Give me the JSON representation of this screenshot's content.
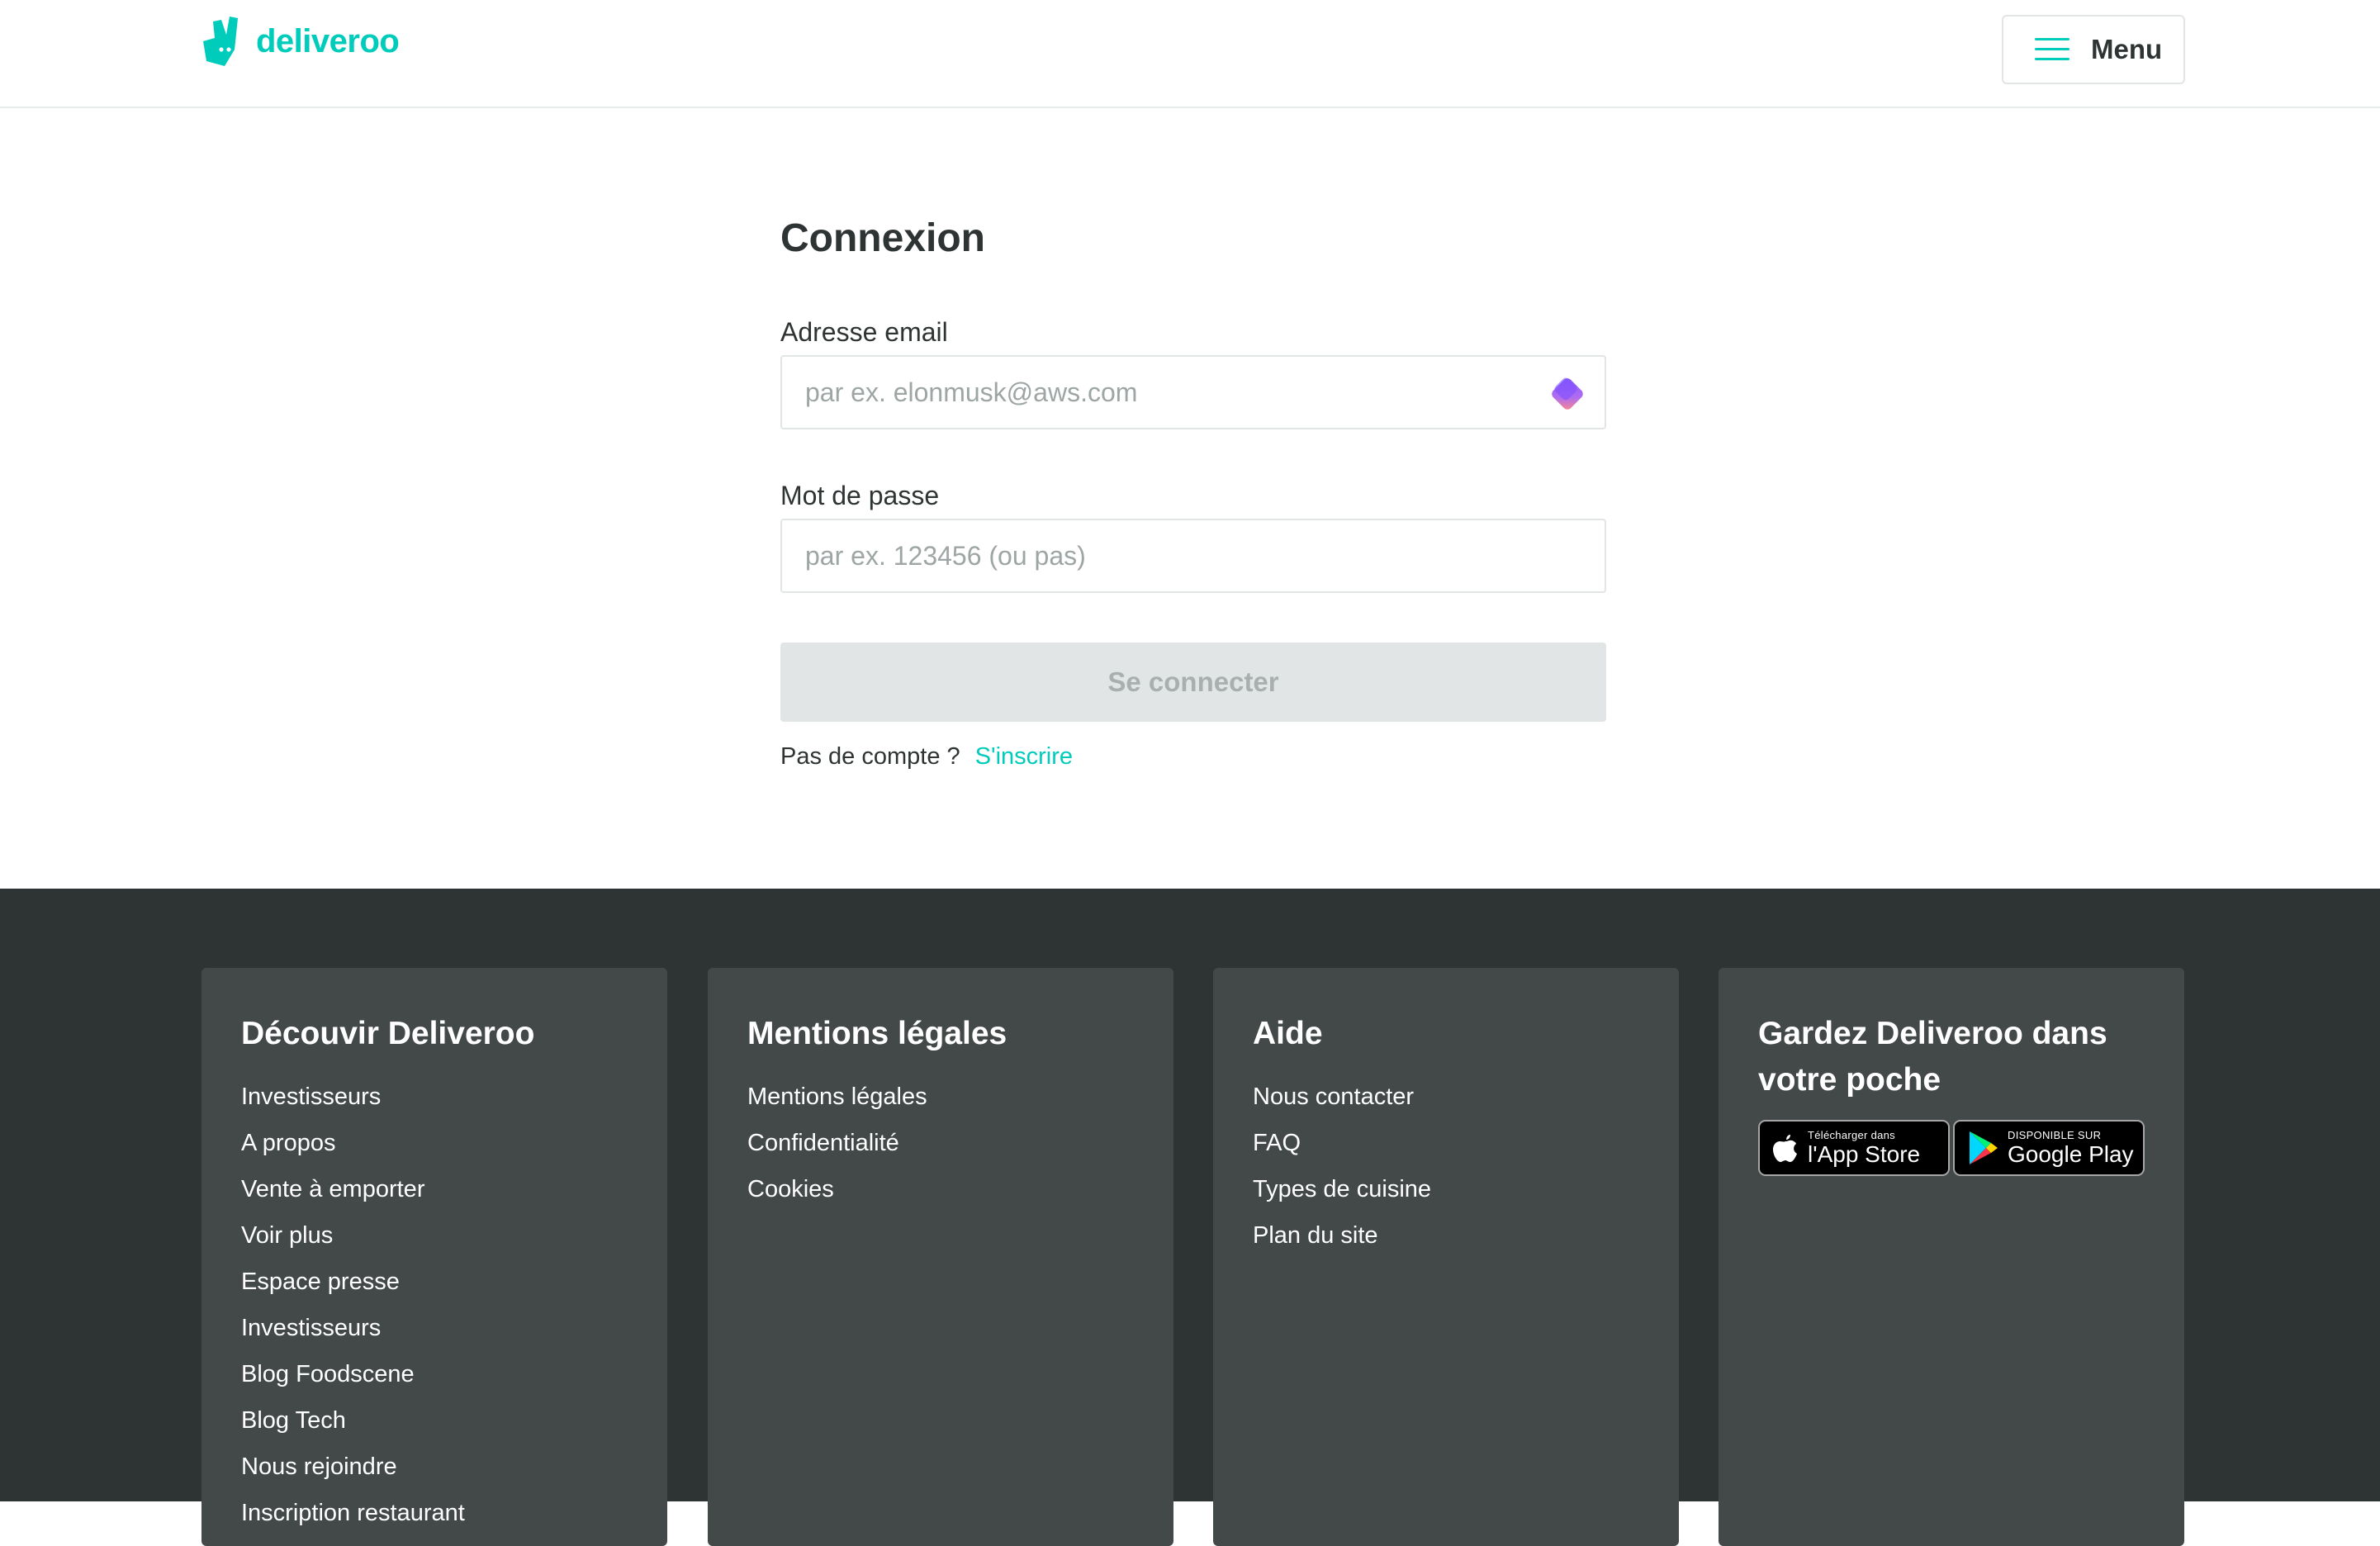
{
  "header": {
    "brand": "deliveroo",
    "menu_label": "Menu"
  },
  "login": {
    "title": "Connexion",
    "email_label": "Adresse email",
    "email_placeholder": "par ex. elonmusk@aws.com",
    "email_value": "",
    "password_label": "Mot de passe",
    "password_placeholder": "par ex. 123456 (ou pas)",
    "password_value": "",
    "submit_label": "Se connecter",
    "no_account_text": "Pas de compte ?",
    "signup_link": "S'inscrire"
  },
  "footer": {
    "columns": [
      {
        "title": "Découvir Deliveroo",
        "links": [
          "Investisseurs",
          "A propos",
          "Vente à emporter",
          "Voir plus",
          "Espace presse",
          "Investisseurs",
          "Blog Foodscene",
          "Blog Tech",
          "Nous rejoindre",
          "Inscription restaurant"
        ]
      },
      {
        "title": "Mentions légales",
        "links": [
          "Mentions légales",
          "Confidentialité",
          "Cookies"
        ]
      },
      {
        "title": "Aide",
        "links": [
          "Nous contacter",
          "FAQ",
          "Types de cuisine",
          "Plan du site"
        ]
      },
      {
        "title": "Gardez Deliveroo dans votre poche",
        "app_store": {
          "small": "Télécharger dans",
          "big": "l'App Store"
        },
        "google_play": {
          "small": "DISPONIBLE SUR",
          "big": "Google Play"
        }
      }
    ]
  },
  "colors": {
    "brand": "#00ccbc",
    "text": "#2e3333",
    "footer_bg": "#2e3333",
    "footer_card": "#434848",
    "disabled_btn": "#e2e5e5"
  },
  "icons": [
    "deliveroo-kangaroo-icon",
    "hamburger-icon",
    "password-manager-icon",
    "apple-icon",
    "google-play-icon"
  ]
}
